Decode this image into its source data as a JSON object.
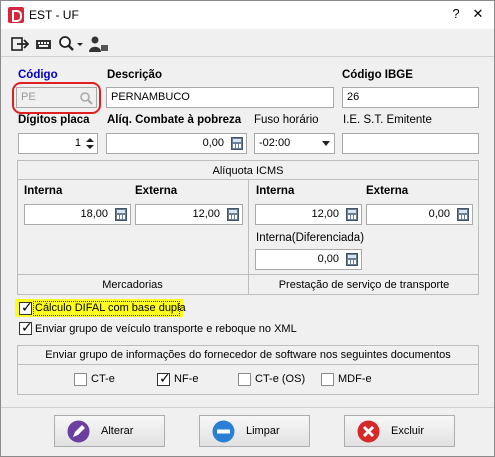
{
  "window": {
    "title": "EST - UF",
    "app_icon": "app-logo-icon",
    "controls": {
      "help": "?",
      "close": "✕"
    }
  },
  "toolbar": {
    "icons": [
      "exit-icon",
      "keyboard-icon",
      "search-dropdown-icon",
      "users-icon"
    ]
  },
  "form": {
    "codigo": {
      "label": "Código",
      "value": "PE"
    },
    "descricao": {
      "label": "Descrição",
      "value": "PERNAMBUCO"
    },
    "codigo_ibge": {
      "label": "Código IBGE",
      "value": "26"
    },
    "digitos_placa": {
      "label": "Dígitos placa",
      "value": "1"
    },
    "aliq_combate": {
      "label": "Alíq. Combate à pobreza",
      "value": "0,00"
    },
    "fuso_horario": {
      "label": "Fuso horário",
      "value": "-02:00"
    },
    "ie_st": {
      "label": "I.E. S.T. Emitente",
      "value": ""
    }
  },
  "aliquota": {
    "title": "Alíquota ICMS",
    "mercadorias": {
      "footer": "Mercadorias",
      "interna_label": "Interna",
      "interna_value": "18,00",
      "externa_label": "Externa",
      "externa_value": "12,00"
    },
    "transporte": {
      "footer": "Prestação de serviço de transporte",
      "interna_label": "Interna",
      "interna_value": "12,00",
      "externa_label": "Externa",
      "externa_value": "0,00",
      "diferenciada_label": "Interna(Diferenciada)",
      "diferenciada_value": "0,00"
    }
  },
  "options": {
    "difal": {
      "label": "Cálculo DIFAL com base dupla",
      "checked": true
    },
    "veiculo": {
      "label": "Enviar grupo de veículo transporte e reboque no XML",
      "checked": true
    }
  },
  "fornecedor": {
    "title": "Enviar grupo de informações do fornecedor de software nos seguintes documentos",
    "docs": [
      {
        "label": "CT-e",
        "checked": false
      },
      {
        "label": "NF-e",
        "checked": true
      },
      {
        "label": "CT-e (OS)",
        "checked": false
      },
      {
        "label": "MDF-e",
        "checked": false
      }
    ]
  },
  "buttons": {
    "alterar": "Alterar",
    "limpar": "Limpar",
    "excluir": "Excluir"
  },
  "colors": {
    "highlight": "#ffff1e",
    "focus_ring": "#e02020",
    "label_blue": "#0000c8"
  }
}
